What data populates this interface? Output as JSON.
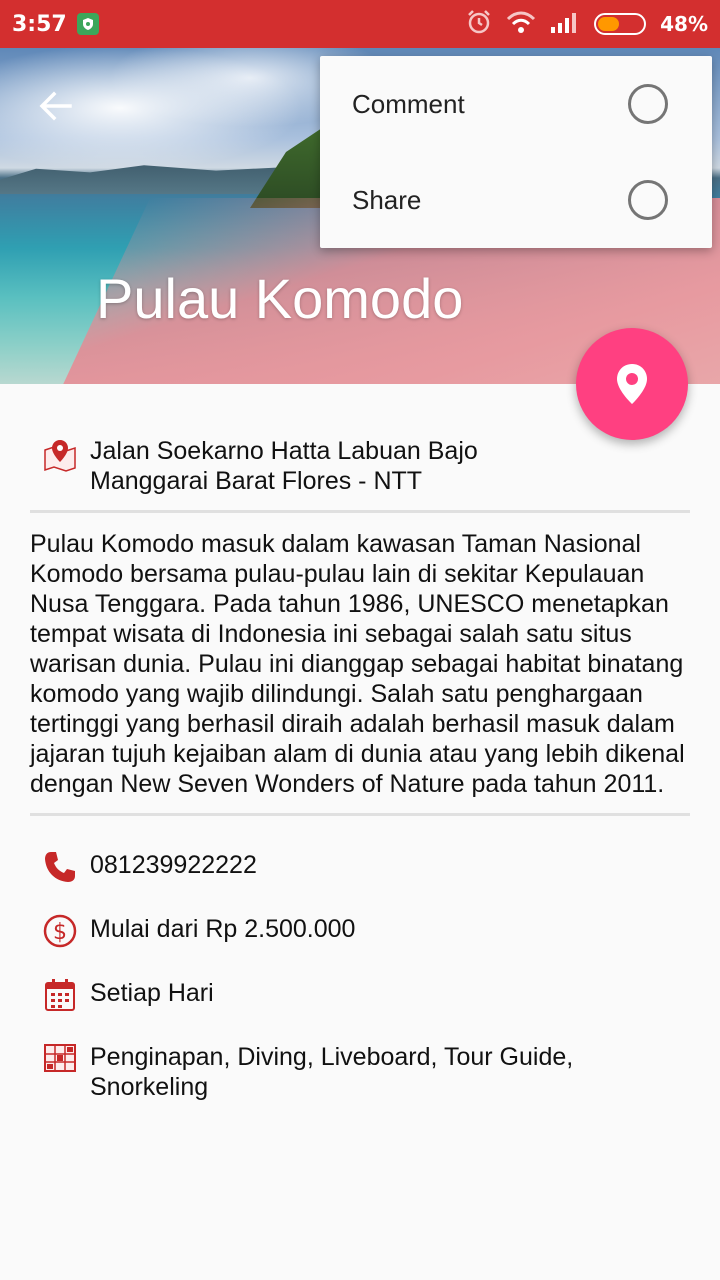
{
  "status": {
    "time": "3:57",
    "battery": "48%",
    "battery_level": 0.48
  },
  "hero": {
    "title": "Pulau Komodo"
  },
  "menu": {
    "items": [
      {
        "label": "Comment"
      },
      {
        "label": "Share"
      }
    ]
  },
  "address": {
    "line1": "Jalan Soekarno Hatta Labuan Bajo",
    "line2": "Manggarai Barat Flores - NTT"
  },
  "description": "Pulau Komodo masuk dalam kawasan Taman Nasional Komodo bersama pulau-pulau lain di sekitar Kepulauan Nusa Tenggara. Pada tahun 1986, UNESCO menetapkan tempat wisata di Indonesia ini sebagai salah satu situs warisan dunia. Pulau ini dianggap sebagai habitat binatang komodo yang wajib dilindungi. Salah satu penghargaan tertinggi yang berhasil diraih adalah berhasil masuk dalam jajaran tujuh kejaiban alam di dunia atau yang lebih dikenal dengan New Seven Wonders of Nature pada tahun 2011.",
  "info": {
    "phone": "081239922222",
    "price": "Mulai dari Rp 2.500.000",
    "schedule": "Setiap Hari",
    "facilities": "Penginapan, Diving, Liveboard, Tour Guide, Snorkeling"
  },
  "colors": {
    "status_bar": "#d32f2f",
    "fab": "#ff4081",
    "icon": "#c62828"
  }
}
